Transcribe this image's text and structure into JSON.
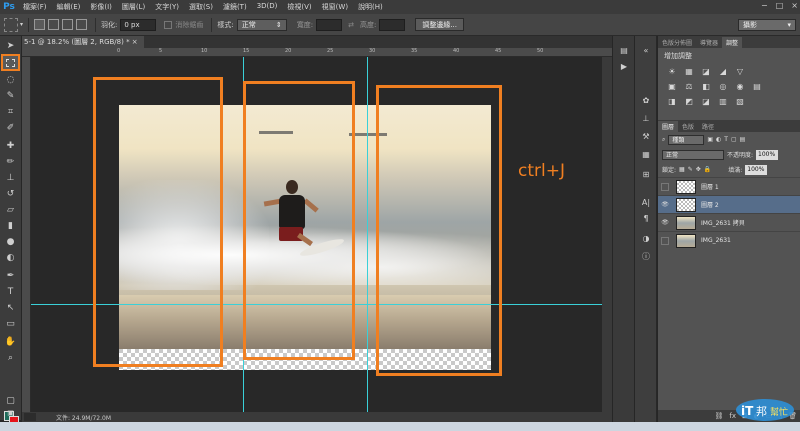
{
  "app": {
    "logo": "Ps"
  },
  "menu": [
    "檔案(F)",
    "編輯(E)",
    "影像(I)",
    "圖層(L)",
    "文字(Y)",
    "選取(S)",
    "濾鏡(T)",
    "3D(D)",
    "檢視(V)",
    "視窗(W)",
    "說明(H)"
  ],
  "window_controls": [
    "−",
    "□",
    "×"
  ],
  "options": {
    "feather_label": "羽化:",
    "feather_value": "0 px",
    "antialias_label": "消除鋸齒",
    "style_label": "樣式:",
    "style_value": "正常",
    "width_label": "寬度:",
    "height_label": "高度:",
    "refine_button": "調整邊緣...",
    "workspace": "攝影"
  },
  "document_tab": "5-1 @ 18.2% (圖層 2, RGB/8) * ×",
  "ruler_ticks": [
    "0",
    "5",
    "10",
    "15",
    "20",
    "25",
    "30",
    "35",
    "40",
    "45",
    "50"
  ],
  "annotation": "ctrl+J",
  "status": {
    "doc_size": "文件: 24.9M/72.0M"
  },
  "panels": {
    "top_tabs": [
      "色版分佈圖",
      "導覽器",
      "調整"
    ],
    "adjust_title": "增加調整",
    "adjust_icons_row1": [
      "☀",
      "▦",
      "◪",
      "◢",
      "▽"
    ],
    "adjust_icons_row2": [
      "▣",
      "⚖",
      "◧",
      "◎",
      "◉",
      "▤"
    ],
    "adjust_icons_row3": [
      "◨",
      "◩",
      "◪",
      "▥",
      "▧"
    ],
    "layer_tabs": [
      "圖層",
      "色版",
      "路徑"
    ],
    "kind_filter": "種類",
    "blend_mode": "正常",
    "opacity_label": "不透明度:",
    "opacity_value": "100%",
    "lock_label": "鎖定:",
    "fill_label": "填滿:",
    "fill_value": "100%",
    "layers": [
      {
        "name": "圖層 1",
        "visible": false,
        "thumb": "checker",
        "selected": false
      },
      {
        "name": "圖層 2",
        "visible": true,
        "thumb": "checker",
        "selected": true
      },
      {
        "name": "IMG_2631 拷貝",
        "visible": true,
        "thumb": "photo",
        "selected": false
      },
      {
        "name": "IMG_2631",
        "visible": false,
        "thumb": "photo",
        "selected": false
      }
    ]
  },
  "watermark": {
    "line1": "iT",
    "line2": "邦",
    "line3": "幫忙"
  }
}
